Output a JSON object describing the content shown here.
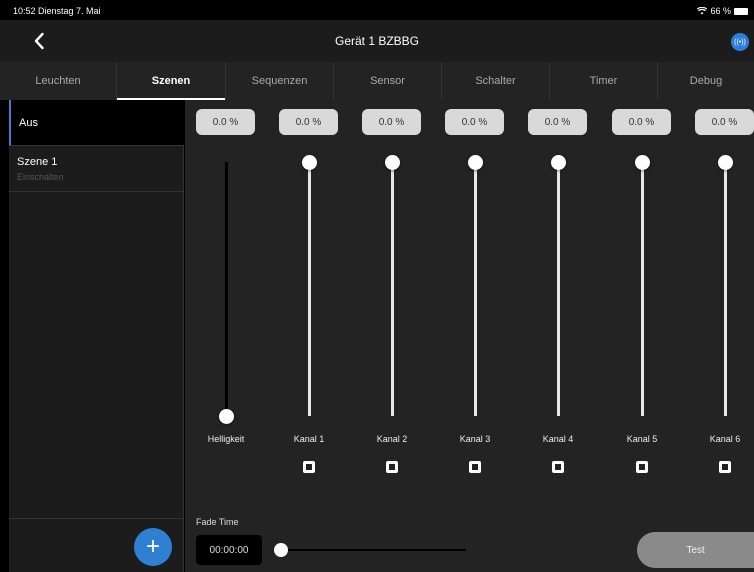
{
  "status_bar": {
    "time_date": "10:52  Dienstag 7. Mai",
    "battery": "66 %"
  },
  "nav": {
    "title": "Gerät 1 BZBBG"
  },
  "tabs": [
    {
      "label": "Leuchten",
      "active": false
    },
    {
      "label": "Szenen",
      "active": true
    },
    {
      "label": "Sequenzen",
      "active": false
    },
    {
      "label": "Sensor",
      "active": false
    },
    {
      "label": "Schalter",
      "active": false
    },
    {
      "label": "Timer",
      "active": false
    },
    {
      "label": "Debug",
      "active": false
    }
  ],
  "scenes": [
    {
      "name": "Aus",
      "subtitle": "",
      "selected": true
    },
    {
      "name": "Szene 1",
      "subtitle": "Einschalten",
      "selected": false
    }
  ],
  "add_button": {
    "label": "+"
  },
  "channels": [
    {
      "label": "Helligkeit",
      "value_text": "0.0 %",
      "level": 0.0,
      "has_checkbox": false
    },
    {
      "label": "Kanal 1",
      "value_text": "0.0 %",
      "level": 0.0,
      "has_checkbox": true
    },
    {
      "label": "Kanal 2",
      "value_text": "0.0 %",
      "level": 0.0,
      "has_checkbox": true
    },
    {
      "label": "Kanal 3",
      "value_text": "0.0 %",
      "level": 0.0,
      "has_checkbox": true
    },
    {
      "label": "Kanal 4",
      "value_text": "0.0 %",
      "level": 0.0,
      "has_checkbox": true
    },
    {
      "label": "Kanal 5",
      "value_text": "0.0 %",
      "level": 0.0,
      "has_checkbox": true
    },
    {
      "label": "Kanal 6",
      "value_text": "0.0 %",
      "level": 0.0,
      "has_checkbox": true
    }
  ],
  "fade": {
    "label": "Fade Time",
    "value": "00:00:00"
  },
  "test_button": {
    "label": "Test"
  },
  "colors": {
    "accent": "#2f80d3",
    "background": "#232323",
    "sidebar": "#1c1c1c"
  }
}
